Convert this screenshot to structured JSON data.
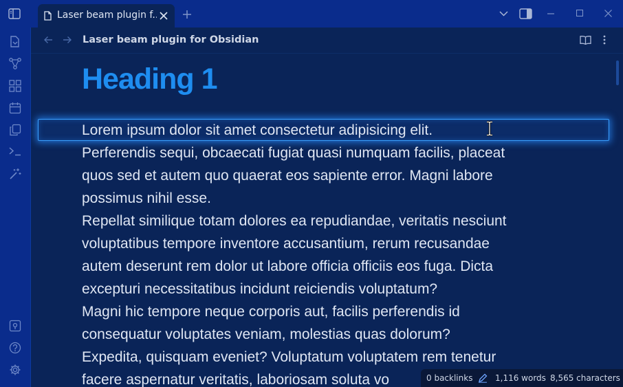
{
  "window": {
    "tab_title": "Laser beam plugin f...",
    "view_title": "Laser beam plugin for Obsidian"
  },
  "ribbon": {
    "top_icons": [
      "sidebar-toggle-icon",
      "open-file-icon",
      "graph-icon",
      "canvas-icon",
      "calendar-icon",
      "copy-icon",
      "terminal-icon",
      "magic-wand-icon"
    ],
    "bottom_icons": [
      "vault-icon",
      "help-icon",
      "settings-icon"
    ]
  },
  "document": {
    "heading": "Heading 1",
    "lines": [
      "Lorem ipsum dolor sit amet consectetur adipisicing elit.",
      "Perferendis sequi, obcaecati fugiat quasi numquam facilis, placeat",
      "quos sed et autem quo quaerat eos sapiente error. Magni labore",
      "possimus nihil esse.",
      "Repellat similique totam dolores ea repudiandae, veritatis nesciunt",
      "voluptatibus tempore inventore accusantium, rerum recusandae",
      "autem deserunt rem dolor ut labore officia officiis eos fuga. Dicta",
      "excepturi necessitatibus incidunt reiciendis voluptatum?",
      "Magni hic tempore neque corporis aut, facilis perferendis id",
      "consequatur voluptates veniam, molestias quas dolorum?",
      "Expedita, quisquam eveniet? Voluptatum voluptatem rem tenetur",
      "facere aspernatur veritatis, laboriosam soluta vo"
    ]
  },
  "status": {
    "backlinks": "0 backlinks",
    "words": "1,116 words",
    "characters": "8,565 characters"
  },
  "colors": {
    "chrome": "#0a2c8c",
    "editor_bg": "#0a2458",
    "heading": "#1e8df0",
    "laser": "#3aa0ff"
  }
}
